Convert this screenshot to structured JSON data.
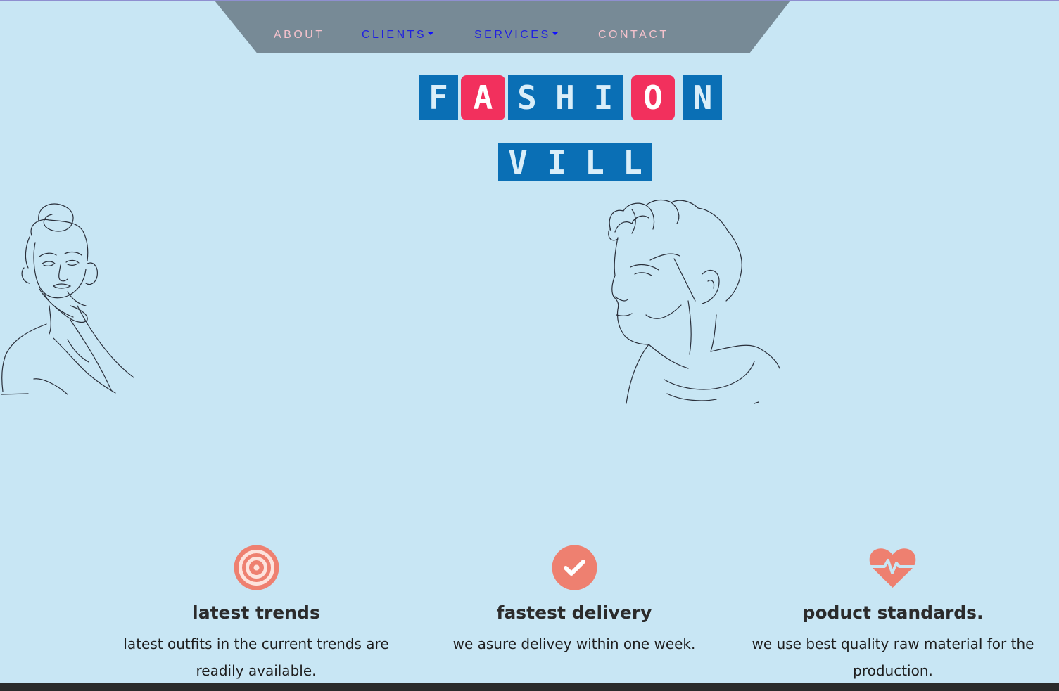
{
  "nav": {
    "about": "ABOUT",
    "clients": "CLIENTS",
    "services": "SERVICES",
    "contact": "CONTACT"
  },
  "logo": {
    "line1": [
      "F",
      "A",
      "S",
      "H",
      "I",
      "O",
      "N"
    ],
    "line2": [
      "V",
      "I",
      "L",
      "L"
    ]
  },
  "features": [
    {
      "icon": "target-icon",
      "title": "latest trends",
      "description": "latest outfits in the current trends are readily available."
    },
    {
      "icon": "check-circle-icon",
      "title": "fastest delivery",
      "description": "we asure delivey within one week."
    },
    {
      "icon": "heartbeat-icon",
      "title": "poduct standards.",
      "description": "we use best quality raw material for the production."
    }
  ],
  "colors": {
    "background": "#c8e6f4",
    "nav": "#778a96",
    "tile_blue": "#0a6fb5",
    "tile_red": "#f2305d",
    "icon": "#ee8070"
  }
}
